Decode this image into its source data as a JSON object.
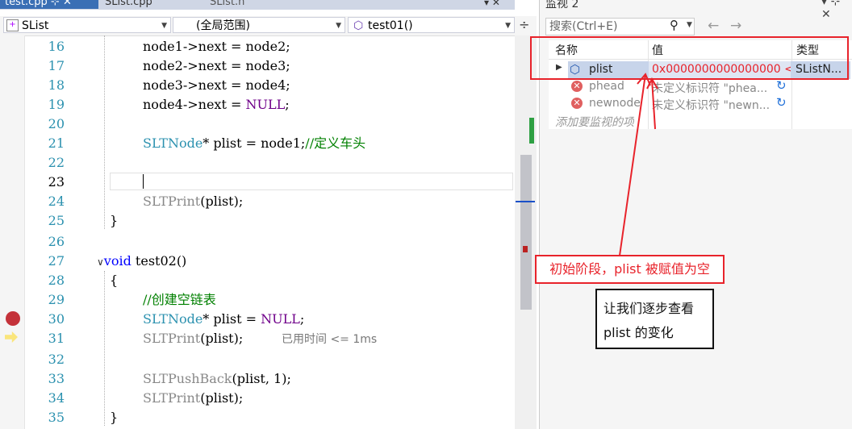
{
  "tabs": {
    "active": "test.cpp",
    "tab2": "SList.cpp",
    "tab3": "SList.h",
    "controls": "▾ ✕"
  },
  "navbar": {
    "project": "SList",
    "scope": "(全局范围)",
    "member": "test01()"
  },
  "editor": {
    "lines": [
      "16",
      "17",
      "18",
      "19",
      "20",
      "21",
      "22",
      "23",
      "24",
      "25",
      "26",
      "27",
      "28",
      "29",
      "30",
      "31",
      "32",
      "33",
      "34",
      "35"
    ],
    "current_line": "23",
    "elapsed": "已用时间 <= 1ms",
    "code": {
      "l16a": "node1->next = node2;",
      "l17a": "node2->next = node3;",
      "l18a": "node3->next = node4;",
      "l19a": "node4->next = ",
      "l19b": "NULL",
      "l19c": ";",
      "l21a": "SLTNode",
      "l21b": "* plist = node1;",
      "l21c": "//定义车头",
      "l24a": "SLTPrint",
      "l24b": "(plist);",
      "l25": "}",
      "l27a": "void",
      "l27b": " test02",
      "l27c": "()",
      "l28": "{",
      "l29": "//创建空链表",
      "l30a": "SLTNode",
      "l30b": "* plist = ",
      "l30c": "NULL",
      "l30d": ";",
      "l31a": "SLTPrint",
      "l31b": "(plist);",
      "l33a": "SLTPushBack",
      "l33b": "(plist, 1);",
      "l34a": "SLTPrint",
      "l34b": "(plist);",
      "l35": "}"
    }
  },
  "watch": {
    "title": "监视 2",
    "controls": "▾ ⊹ ✕",
    "search_placeholder": "搜索(Ctrl+E)",
    "columns": {
      "name": "名称",
      "value": "值",
      "type": "类型"
    },
    "rows": [
      {
        "name": "plist",
        "value": "0x0000000000000000 <...",
        "type": "SListN..."
      },
      {
        "name": "phead",
        "value": "未定义标识符 \"phea...",
        "type": ""
      },
      {
        "name": "newnode",
        "value": "未定义标识符 \"newn...",
        "type": ""
      }
    ],
    "add_item": "添加要监视的项"
  },
  "annotations": {
    "callout_red": "初始阶段，plist 被赋值为空",
    "callout_black_line1": "让我们逐步查看",
    "callout_black_line2": "plist 的变化"
  },
  "colors": {
    "type": "#2b91af",
    "macro": "#6f008a",
    "comment": "#008000",
    "keyword": "#0000ff",
    "annotation_red": "#e8232b"
  },
  "icons": {
    "breakpoint": "breakpoint-icon",
    "current_statement": "current-statement-arrow-icon",
    "search": "search-icon",
    "error": "error-icon",
    "refresh": "refresh-icon"
  }
}
